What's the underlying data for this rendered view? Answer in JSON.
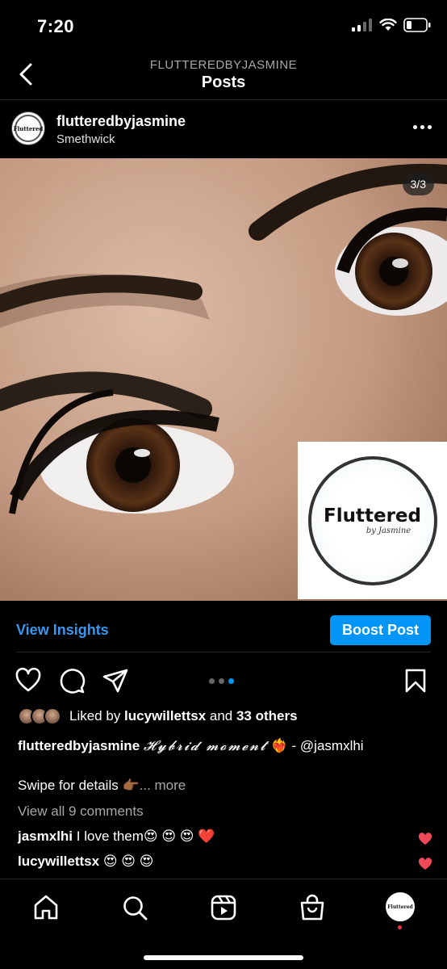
{
  "status": {
    "time": "7:20"
  },
  "nav": {
    "subtitle": "FLUTTEREDBYJASMINE",
    "title": "Posts"
  },
  "post": {
    "username": "flutteredbyjasmine",
    "location": "Smethwick",
    "avatar_text": "Fluttered",
    "counter": "3/3",
    "logo_word": "Fluttered",
    "logo_sub": "by Jasmine"
  },
  "insights": {
    "view_insights": "View Insights",
    "boost": "Boost Post"
  },
  "carousel": {
    "pages": 3,
    "active": 3
  },
  "likes": {
    "prefix": "Liked by ",
    "user": "lucywillettsx",
    "middle": " and ",
    "others": "33 others"
  },
  "caption": {
    "username": "flutteredbyjasmine",
    "text": "𝓗𝔂𝓫𝓻𝓲𝓭 𝓶𝓸𝓶𝓮𝓷𝓽",
    "emoji": "❤️‍🔥",
    "mention": " - @jasmxlhi",
    "swipe": "Swipe for details 👉🏾",
    "more": "... more"
  },
  "comments": {
    "view_all": "View all 9 comments",
    "items": [
      {
        "user": "jasmxlhi",
        "text": " I love them😍 😍 😍 ❤️"
      },
      {
        "user": "lucywillettsx",
        "text": " 😍 😍 😍"
      }
    ]
  },
  "tab_avatar_text": "Fluttered",
  "colors": {
    "accent": "#0095f6",
    "link": "#3897f0",
    "heart": "#ed4956",
    "background": "#000000"
  },
  "icons": [
    "back-icon",
    "more-icon",
    "heart-icon",
    "comment-icon",
    "share-icon",
    "bookmark-icon",
    "home-icon",
    "search-icon",
    "reels-icon",
    "shop-icon"
  ]
}
